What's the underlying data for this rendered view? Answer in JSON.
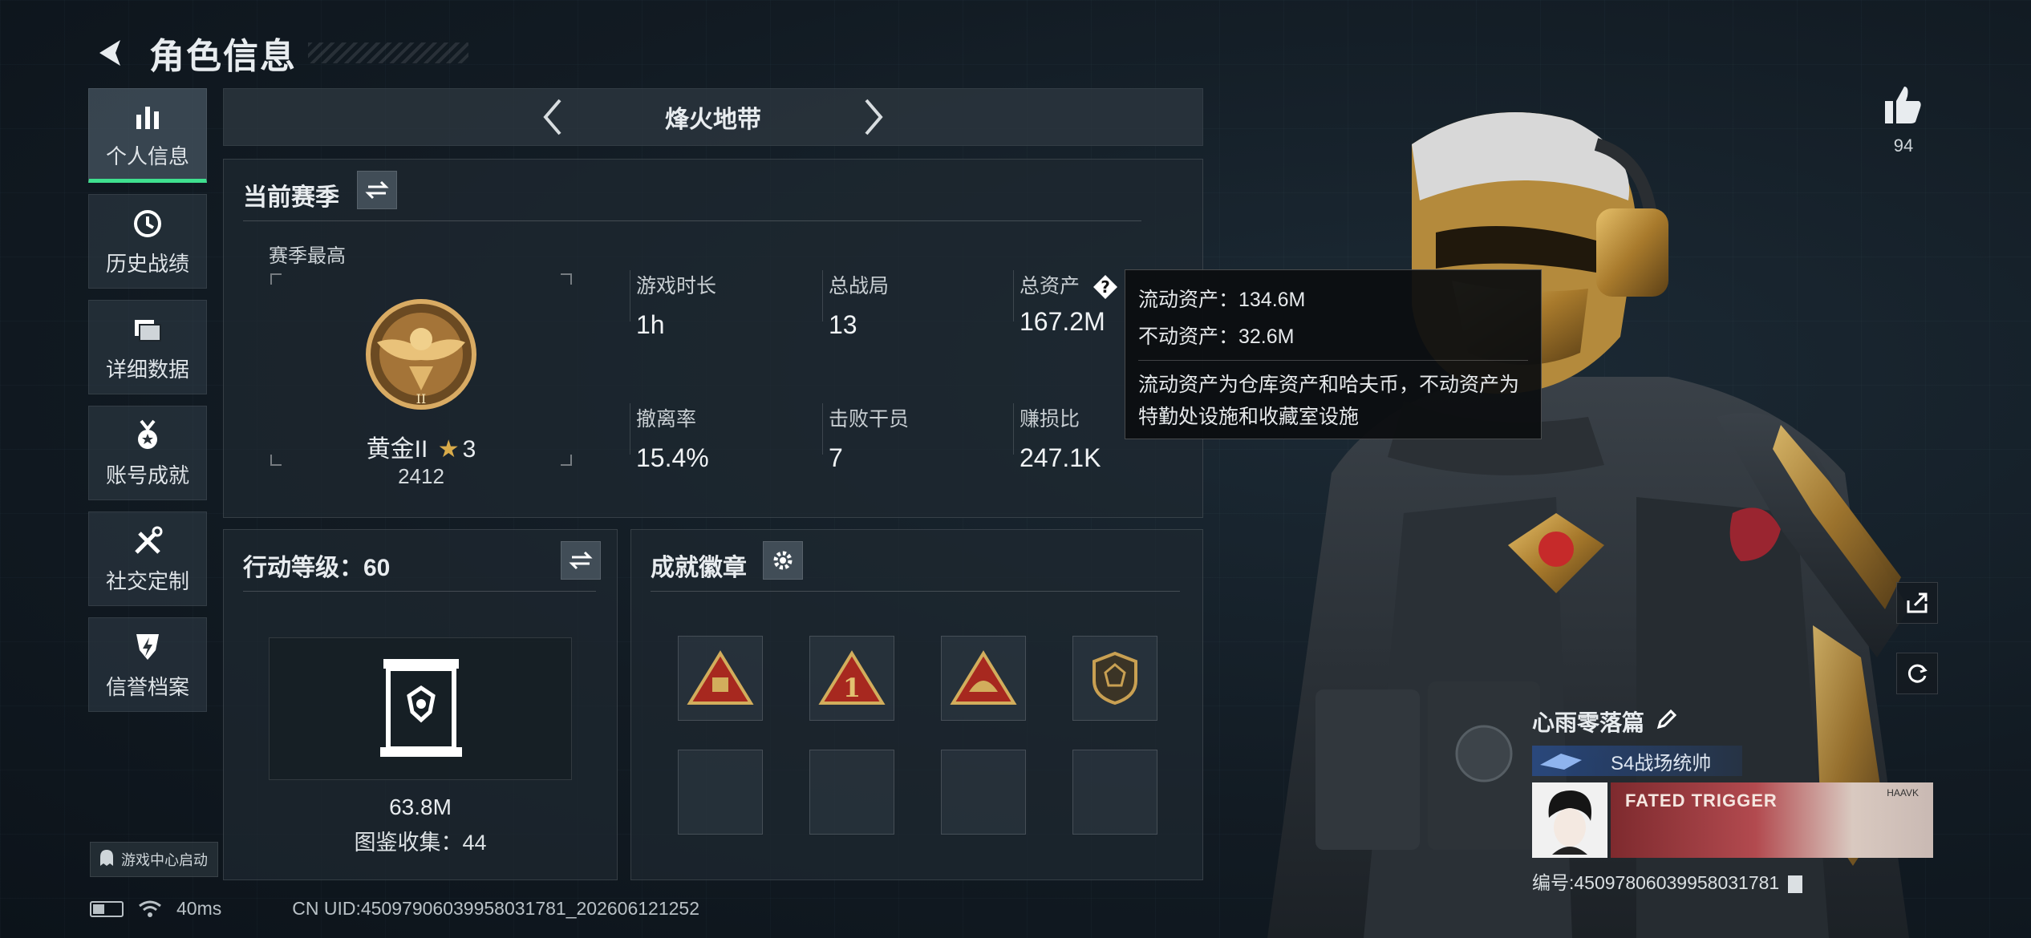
{
  "header": {
    "title": "角色信息"
  },
  "sidebar": {
    "items": [
      {
        "label": "个人信息",
        "icon": "bar-chart-icon",
        "active": true
      },
      {
        "label": "历史战绩",
        "icon": "clock-history-icon",
        "active": false
      },
      {
        "label": "详细数据",
        "icon": "folder-icon",
        "active": false
      },
      {
        "label": "账号成就",
        "icon": "medal-icon",
        "active": false
      },
      {
        "label": "社交定制",
        "icon": "tools-icon",
        "active": false
      },
      {
        "label": "信誉档案",
        "icon": "shield-lightning-icon",
        "active": false
      }
    ],
    "footer": "游戏中心启动"
  },
  "mode": {
    "title": "烽火地带"
  },
  "season": {
    "title": "当前赛季",
    "best_label": "赛季最高",
    "rank_name": "黄金II",
    "rank_stars": "3",
    "rank_score": "2412",
    "stats": [
      {
        "label": "游戏时长",
        "value": "1h"
      },
      {
        "label": "总战局",
        "value": "13"
      },
      {
        "label": "总资产",
        "value": "167.2M"
      },
      {
        "label": "撤离率",
        "value": "15.4%"
      },
      {
        "label": "击败干员",
        "value": "7"
      },
      {
        "label": "赚损比",
        "value": "247.1K"
      }
    ]
  },
  "tooltip": {
    "liquid": "流动资产：134.6M",
    "fixed": "不动资产：32.6M",
    "description": "流动资产为仓库资产和哈夫币，不动资产为特勤处设施和收藏室设施"
  },
  "action_level": {
    "title": "行动等级：60",
    "gallery_value": "63.8M",
    "gallery_count": "图鉴收集：44"
  },
  "achievements": {
    "title": "成就徽章"
  },
  "likes": {
    "count": "94"
  },
  "player": {
    "name": "心雨零落篇",
    "title": "S4战场统帅",
    "banner_text": "FATED TRIGGER",
    "banner_small": "HAAVK",
    "id": "编号:450978060399580317​81"
  },
  "status": {
    "ping": "40ms",
    "uid": "CN UID:4509790603995803178​1_202606121252"
  },
  "colors": {
    "accent": "#3fe08f",
    "gold": "#c9a052",
    "rank": "#b8864a"
  }
}
